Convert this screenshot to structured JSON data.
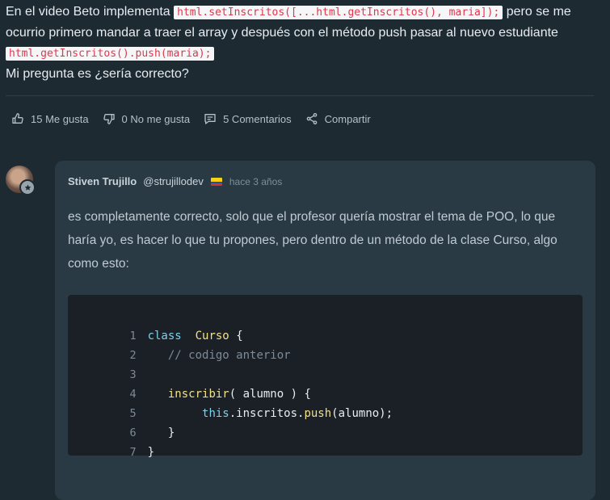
{
  "question": {
    "line1_prefix": "En el video Beto implementa",
    "code1": "html.setInscritos([...html.getInscritos(), maria]);",
    "line1_suffix": "pero se me ocurrio primero mandar a traer el array y después con el método push pasar al nuevo estudiante",
    "code2": "html.getInscritos().push(maria);",
    "line3": "Mi pregunta es ¿sería correcto?"
  },
  "actions": {
    "like": "15 Me gusta",
    "dislike": "0 No me gusta",
    "comments": "5 Comentarios",
    "share": "Compartir"
  },
  "comment": {
    "author": "Stiven Trujillo",
    "handle": "@strujillodev",
    "flag_icon": "colombia-flag-icon",
    "flag_colors": [
      "#f7d116",
      "#1f4fa3",
      "#d32f2f"
    ],
    "timestamp": "hace 3 años",
    "body": "es completamente correcto, solo que el profesor quería mostrar el tema de POO, lo que haría yo, es hacer lo que tu propones, pero dentro de un método de la clase Curso, algo como esto:",
    "code": {
      "line_numbers": [
        "1",
        "2",
        "3",
        "4",
        "5",
        "6",
        "7"
      ],
      "l1_kw": "class",
      "l1_cls": "Curso",
      "l1_brace": "{",
      "l2_comment": "// codigo anterior",
      "l4_fn": "inscribir",
      "l4_rest": "( alumno ) {",
      "l5_this": "this",
      "l5_mid": ".inscritos.",
      "l5_method": "push",
      "l5_rest": "(alumno);",
      "l6": "}",
      "l7": "}"
    }
  },
  "colors": {
    "background": "#1e2a32",
    "card": "#2a3a44",
    "code_bg": "#1a2026",
    "inline_code_text": "#e0374b"
  }
}
